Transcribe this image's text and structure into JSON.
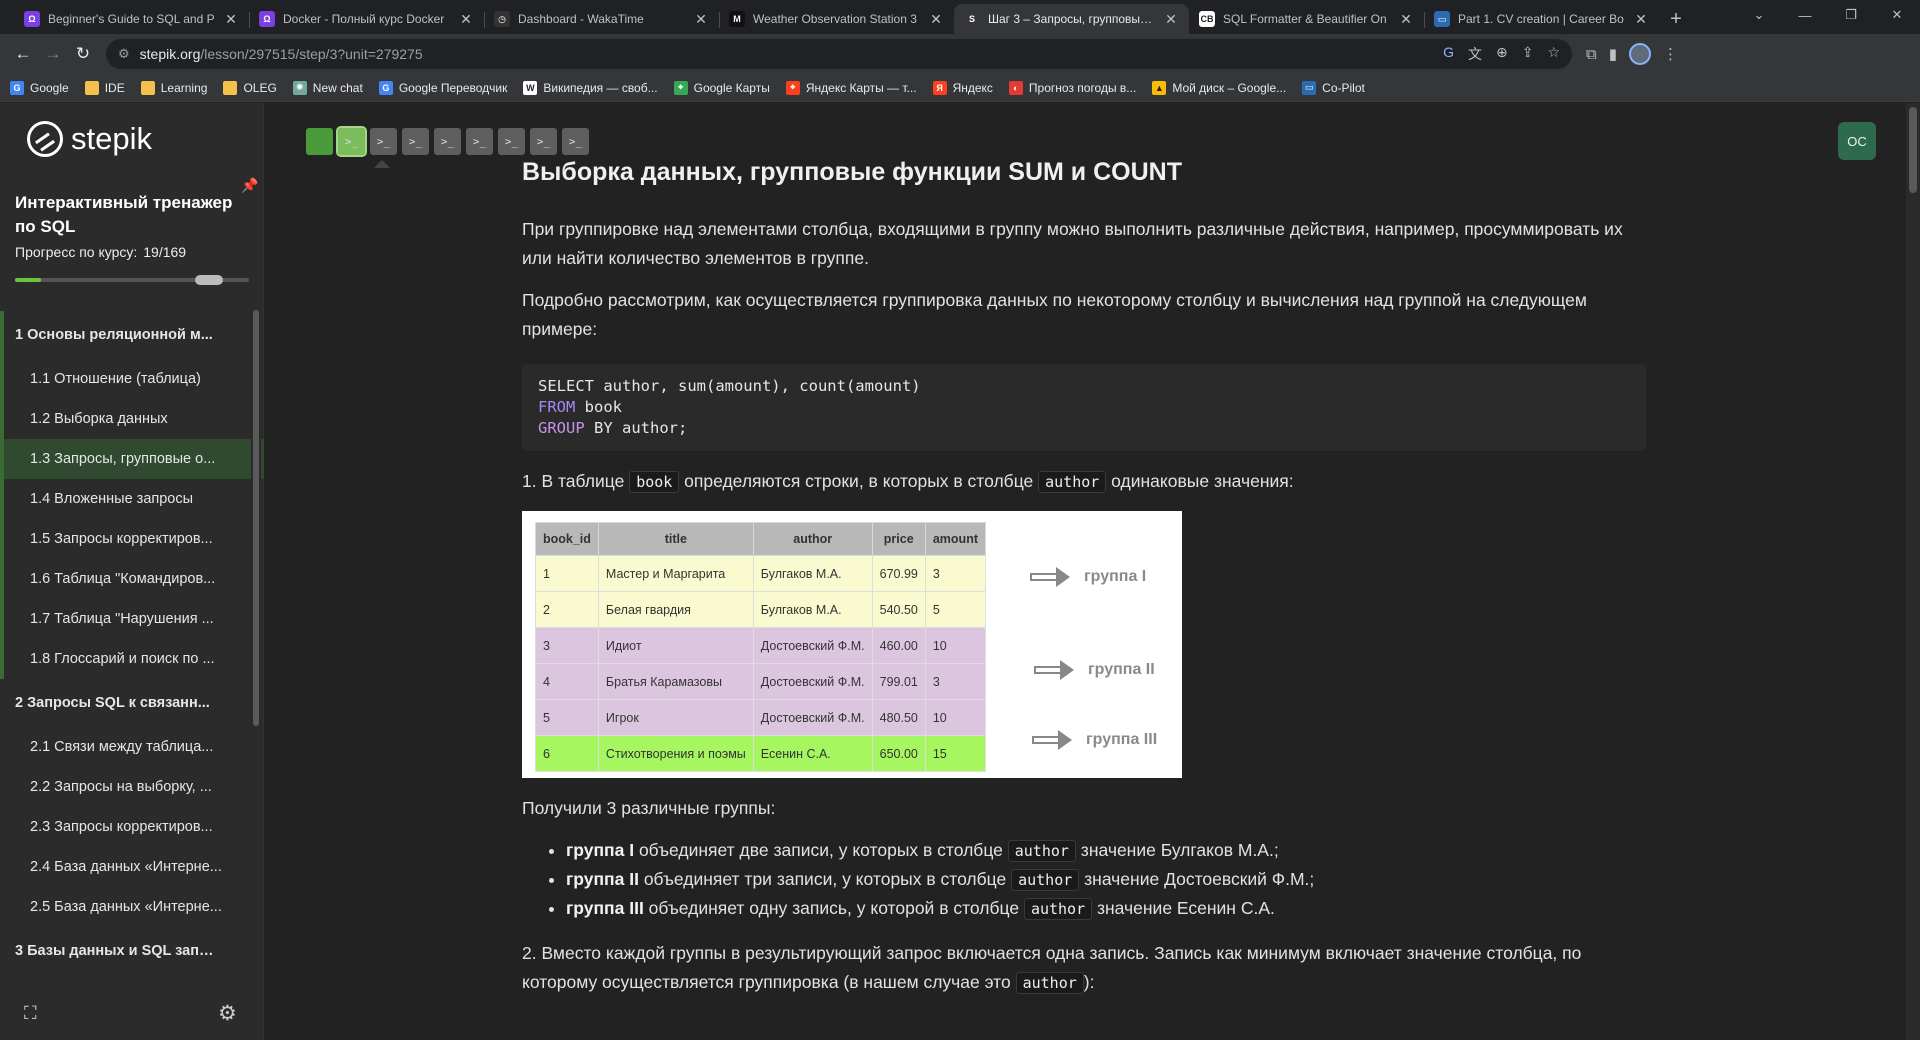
{
  "browser": {
    "tabs": [
      {
        "title": "Beginner's Guide to SQL and P",
        "color": "#7b3fe4",
        "glyph": "Ω",
        "active": false
      },
      {
        "title": "Docker - Полный курс Docker",
        "color": "#7b3fe4",
        "glyph": "Ω",
        "active": false
      },
      {
        "title": "Dashboard - WakaTime",
        "color": "#333333",
        "glyph": "◷",
        "active": false
      },
      {
        "title": "Weather Observation Station 3",
        "color": "#111111",
        "glyph": "M",
        "active": false
      },
      {
        "title": "Шаг 3 – Запросы, групповые о",
        "color": "#35363a",
        "glyph": "S",
        "active": true
      },
      {
        "title": "SQL Formatter & Beautifier On",
        "color": "#ffffff",
        "glyph": "CB",
        "active": false
      },
      {
        "title": "Part 1. CV creation | Career Bo",
        "color": "#2b6cb0",
        "glyph": "▭",
        "active": false
      }
    ],
    "url_host": "stepik.org",
    "url_path": "/lesson/297515/step/3?unit=279275",
    "bookmarks": [
      {
        "label": "Google",
        "icon": "google-icon",
        "color": "#4285f4",
        "glyph": "G"
      },
      {
        "label": "IDE",
        "icon": "folder-icon",
        "color": "#f2c14e",
        "glyph": ""
      },
      {
        "label": "Learning",
        "icon": "folder-icon",
        "color": "#f2c14e",
        "glyph": ""
      },
      {
        "label": "OLEG",
        "icon": "folder-icon",
        "color": "#f2c14e",
        "glyph": ""
      },
      {
        "label": "New chat",
        "icon": "chatgpt-icon",
        "color": "#74aa9c",
        "glyph": "✺"
      },
      {
        "label": "Google Переводчик",
        "icon": "translate-icon",
        "color": "#4285f4",
        "glyph": "G"
      },
      {
        "label": "Википедия — своб...",
        "icon": "wikipedia-icon",
        "color": "#ffffff",
        "glyph": "W"
      },
      {
        "label": "Google Карты",
        "icon": "maps-icon",
        "color": "#34a853",
        "glyph": "⌖"
      },
      {
        "label": "Яндекс Карты — т...",
        "icon": "yandex-maps-icon",
        "color": "#fc3f1d",
        "glyph": "⌖"
      },
      {
        "label": "Яндекс",
        "icon": "yandex-icon",
        "color": "#fc3f1d",
        "glyph": "Я"
      },
      {
        "label": "Прогноз погоды в...",
        "icon": "weather-icon",
        "color": "#e53935",
        "glyph": "◐"
      },
      {
        "label": "Мой диск – Google...",
        "icon": "drive-icon",
        "color": "#fbbc04",
        "glyph": "▲"
      },
      {
        "label": "Co-Pilot",
        "icon": "copilot-icon",
        "color": "#2b6cb0",
        "glyph": "▭"
      }
    ]
  },
  "sidebar": {
    "logo_text": "stepik",
    "course_title": "Интерактивный тренажер по SQL",
    "progress_label": "Прогресс по курсу:",
    "progress_value": "19/169",
    "progress_fraction": 0.112,
    "toc": [
      {
        "label": "1  Основы реляционной м...",
        "kind": "module",
        "current": false
      },
      {
        "label": "1.1  Отношение (таблица)",
        "kind": "lesson",
        "current": false
      },
      {
        "label": "1.2  Выборка данных",
        "kind": "lesson",
        "current": false
      },
      {
        "label": "1.3  Запросы, групповые о...",
        "kind": "lesson",
        "current": true
      },
      {
        "label": "1.4  Вложенные запросы",
        "kind": "lesson",
        "current": false
      },
      {
        "label": "1.5  Запросы корректиров...",
        "kind": "lesson",
        "current": false
      },
      {
        "label": "1.6  Таблица \"Командиров...",
        "kind": "lesson",
        "current": false
      },
      {
        "label": "1.7  Таблица \"Нарушения ...",
        "kind": "lesson",
        "current": false
      },
      {
        "label": "1.8  Глоссарий и поиск по ...",
        "kind": "lesson",
        "current": false
      },
      {
        "label": "2  Запросы SQL к связанн...",
        "kind": "module",
        "current": false
      },
      {
        "label": "2.1  Связи между таблица...",
        "kind": "lesson",
        "current": false
      },
      {
        "label": "2.2  Запросы на выборку, ...",
        "kind": "lesson",
        "current": false
      },
      {
        "label": "2.3  Запросы корректиров...",
        "kind": "lesson",
        "current": false
      },
      {
        "label": "2.4  База данных «Интерне...",
        "kind": "lesson",
        "current": false
      },
      {
        "label": "2.5  База данных «Интерне...",
        "kind": "lesson",
        "current": false
      },
      {
        "label": "3  Базы данных и SQL запр...",
        "kind": "module",
        "current": false
      }
    ]
  },
  "steps": [
    {
      "state": "done",
      "glyph": ""
    },
    {
      "state": "current",
      "glyph": ">_"
    },
    {
      "state": "todo",
      "glyph": ">_"
    },
    {
      "state": "todo",
      "glyph": ">_"
    },
    {
      "state": "todo",
      "glyph": ">_"
    },
    {
      "state": "todo",
      "glyph": ">_"
    },
    {
      "state": "todo",
      "glyph": ">_"
    },
    {
      "state": "todo",
      "glyph": ">_"
    },
    {
      "state": "todo",
      "glyph": ">_"
    }
  ],
  "user": {
    "initials": "ОС"
  },
  "article": {
    "title": "Выборка данных, групповые функции SUM и COUNT",
    "p1": "При группировке над элементами столбца, входящими в группу можно выполнить различные действия, например, просуммировать их или найти количество элементов в группе.",
    "p2": "Подробно рассмотрим, как осуществляется группировка данных по некоторому столбцу и вычисления над группой на следующем примере:",
    "code": {
      "line1_kw": "SELECT",
      "line1_rest": " author, sum(amount), count(amount)",
      "line2_kw": "FROM",
      "line2_rest": " book",
      "line3_kw": "GROUP",
      "line3_rest": " BY author;"
    },
    "step1_a": "1. В таблице ",
    "step1_code1": "book",
    "step1_b": " определяются строки, в которых в столбце ",
    "step1_code2": "author",
    "step1_c": " одинаковые значения:",
    "table": {
      "headers": [
        "book_id",
        "title",
        "author",
        "price",
        "amount"
      ],
      "rows": [
        [
          "1",
          "Мастер и Маргарита",
          "Булгаков М.А.",
          "670.99",
          "3"
        ],
        [
          "2",
          "Белая гвардия",
          "Булгаков М.А.",
          "540.50",
          "5"
        ],
        [
          "3",
          "Идиот",
          "Достоевский Ф.М.",
          "460.00",
          "10"
        ],
        [
          "4",
          "Братья Карамазовы",
          "Достоевский Ф.М.",
          "799.01",
          "3"
        ],
        [
          "5",
          "Игрок",
          "Достоевский Ф.М.",
          "480.50",
          "10"
        ],
        [
          "6",
          "Стихотворения и поэмы",
          "Есенин С.А.",
          "650.00",
          "15"
        ]
      ],
      "groups": [
        "группа I",
        "группа II",
        "группа III"
      ]
    },
    "result_text": "Получили 3 различные группы:",
    "bullets": [
      {
        "bold": "группа I",
        "text": " объединяет две записи, у которых в столбце ",
        "code": "author",
        "tail": " значение Булгаков М.А.;"
      },
      {
        "bold": "группа II",
        "text": " объединяет три записи, у которых в столбце ",
        "code": "author",
        "tail": " значение Достоевский Ф.М.;"
      },
      {
        "bold": "группа III",
        "text": " объединяет одну запись, у которой в столбце ",
        "code": "author",
        "tail": " значение Есенин С.А."
      }
    ],
    "step2_a": "2. Вместо каждой группы в результирующий запрос включается  одна запись. Запись как минимум включает значение столбца, по которому осуществляется группировка (в нашем случае это ",
    "step2_code": "author",
    "step2_b": "):"
  }
}
